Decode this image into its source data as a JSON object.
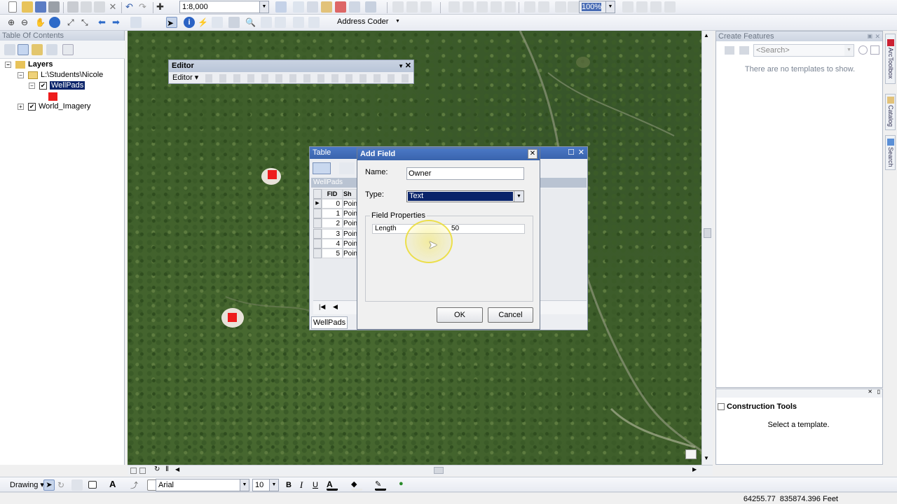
{
  "toolbar1": {
    "scale_value": "1:8,000",
    "zoom_value": "100%"
  },
  "toolbar2": {
    "geocoder_value": "Address Coder"
  },
  "toc": {
    "title": "Table Of Contents",
    "layers_label": "Layers",
    "folder_label": "L:\\Students\\Nicole",
    "layer1": "WellPads",
    "layer2": "World_Imagery"
  },
  "editor": {
    "title": "Editor",
    "menu_label": "Editor ▾"
  },
  "table_window": {
    "title": "Table",
    "layer_label": "WellPads",
    "columns": [
      "FID",
      "Sh"
    ],
    "rows": [
      {
        "fid": "0",
        "shape": "Poin"
      },
      {
        "fid": "1",
        "shape": "Poin"
      },
      {
        "fid": "2",
        "shape": "Poin"
      },
      {
        "fid": "3",
        "shape": "Poin"
      },
      {
        "fid": "4",
        "shape": "Poin"
      },
      {
        "fid": "5",
        "shape": "Poin"
      }
    ],
    "tab_label": "WellPads"
  },
  "add_field": {
    "title": "Add Field",
    "name_label": "Name:",
    "name_value": "Owner",
    "type_label": "Type:",
    "type_value": "Text",
    "group_label": "Field Properties",
    "length_label": "Length",
    "length_value": "50",
    "ok_label": "OK",
    "cancel_label": "Cancel"
  },
  "create_features": {
    "title": "Create Features",
    "search_placeholder": "<Search>",
    "empty_text": "There are no templates to show."
  },
  "construction_tools": {
    "title": "Construction Tools",
    "hint": "Select a template."
  },
  "side_tabs": [
    "ArcToolbox",
    "Catalog",
    "Search"
  ],
  "drawing_toolbar": {
    "drawing_label": "Drawing ▾",
    "font_value": "Arial",
    "size_value": "10",
    "bold": "B",
    "italic": "I",
    "underline": "U"
  },
  "status_bar": {
    "coordinates": "64255.77  835874.396 Feet"
  },
  "colors": {
    "feature_red": "#ee1c1c",
    "selection_blue": "#0a246a",
    "highlight_yellow": "#f5e642"
  }
}
